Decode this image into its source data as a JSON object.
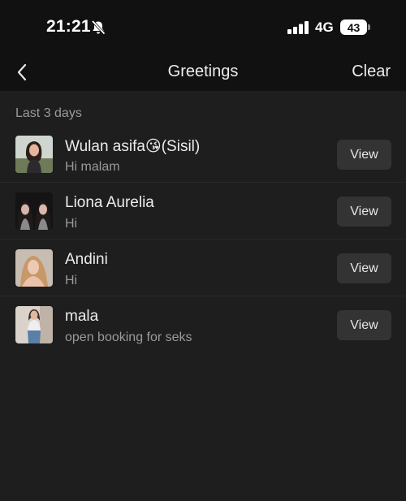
{
  "status_bar": {
    "time": "21:21",
    "network": "4G",
    "battery": "43"
  },
  "nav": {
    "title": "Greetings",
    "clear_label": "Clear"
  },
  "section": {
    "label": "Last 3 days"
  },
  "greetings": [
    {
      "name": "Wulan asifa😘(Sisil)",
      "message": "Hi malam",
      "action": "View"
    },
    {
      "name": "Liona Aurelia",
      "message": "Hi",
      "action": "View"
    },
    {
      "name": "Andini",
      "message": "Hi",
      "action": "View"
    },
    {
      "name": "mala",
      "message": "open booking for seks",
      "action": "View"
    }
  ],
  "icons": {
    "back": "chevron-left-icon",
    "mute": "bell-off-icon",
    "signal": "signal-bars-icon",
    "battery": "battery-icon"
  },
  "colors": {
    "background": "#1e1e1e",
    "header": "#111111",
    "button": "#333333",
    "secondary_text": "#9a9a9a"
  }
}
